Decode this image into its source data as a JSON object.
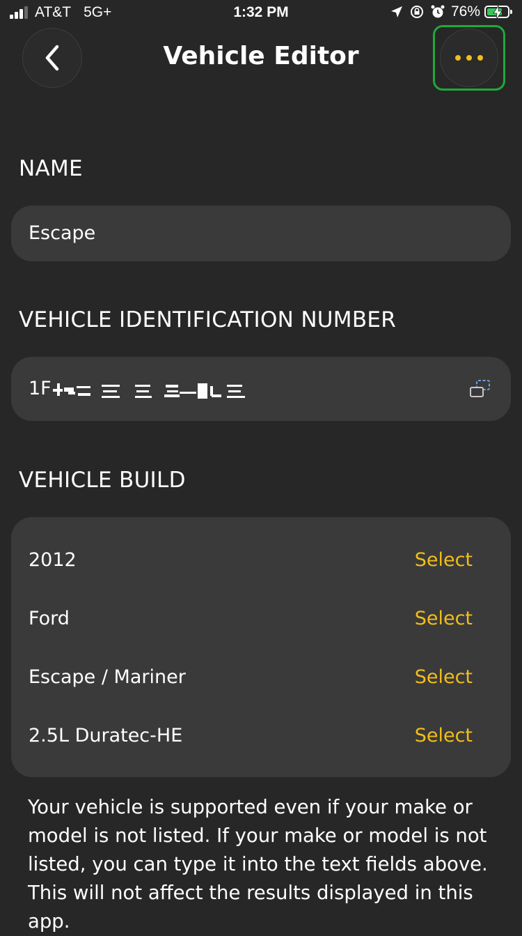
{
  "status_bar": {
    "carrier": "AT&T",
    "network": "5G+",
    "time": "1:32 PM",
    "battery_percent": "76%",
    "battery_level": 0.76,
    "signal_bars_on": 3,
    "signal_bars_total": 4
  },
  "header": {
    "title": "Vehicle Editor",
    "back_icon": "chevron-left-icon",
    "more_icon": "more-dots-icon",
    "accent_color": "#f2be1a",
    "highlight_color": "#1fa83a"
  },
  "name_section": {
    "label": "NAME",
    "value": "Escape"
  },
  "vin_section": {
    "label": "VEHICLE IDENTIFICATION NUMBER",
    "value_prefix": "1F",
    "value_redacted": true,
    "copy_icon": "copy-icon"
  },
  "build_section": {
    "label": "VEHICLE BUILD",
    "rows": [
      {
        "value": "2012",
        "action": "Select"
      },
      {
        "value": "Ford",
        "action": "Select"
      },
      {
        "value": "Escape / Mariner",
        "action": "Select"
      },
      {
        "value": "2.5L Duratec-HE",
        "action": "Select"
      }
    ]
  },
  "note": "Your vehicle is supported even if your make or model is not listed. If your make or model is not listed, you can type it into the text fields above. This will not affect the results displayed in this app."
}
